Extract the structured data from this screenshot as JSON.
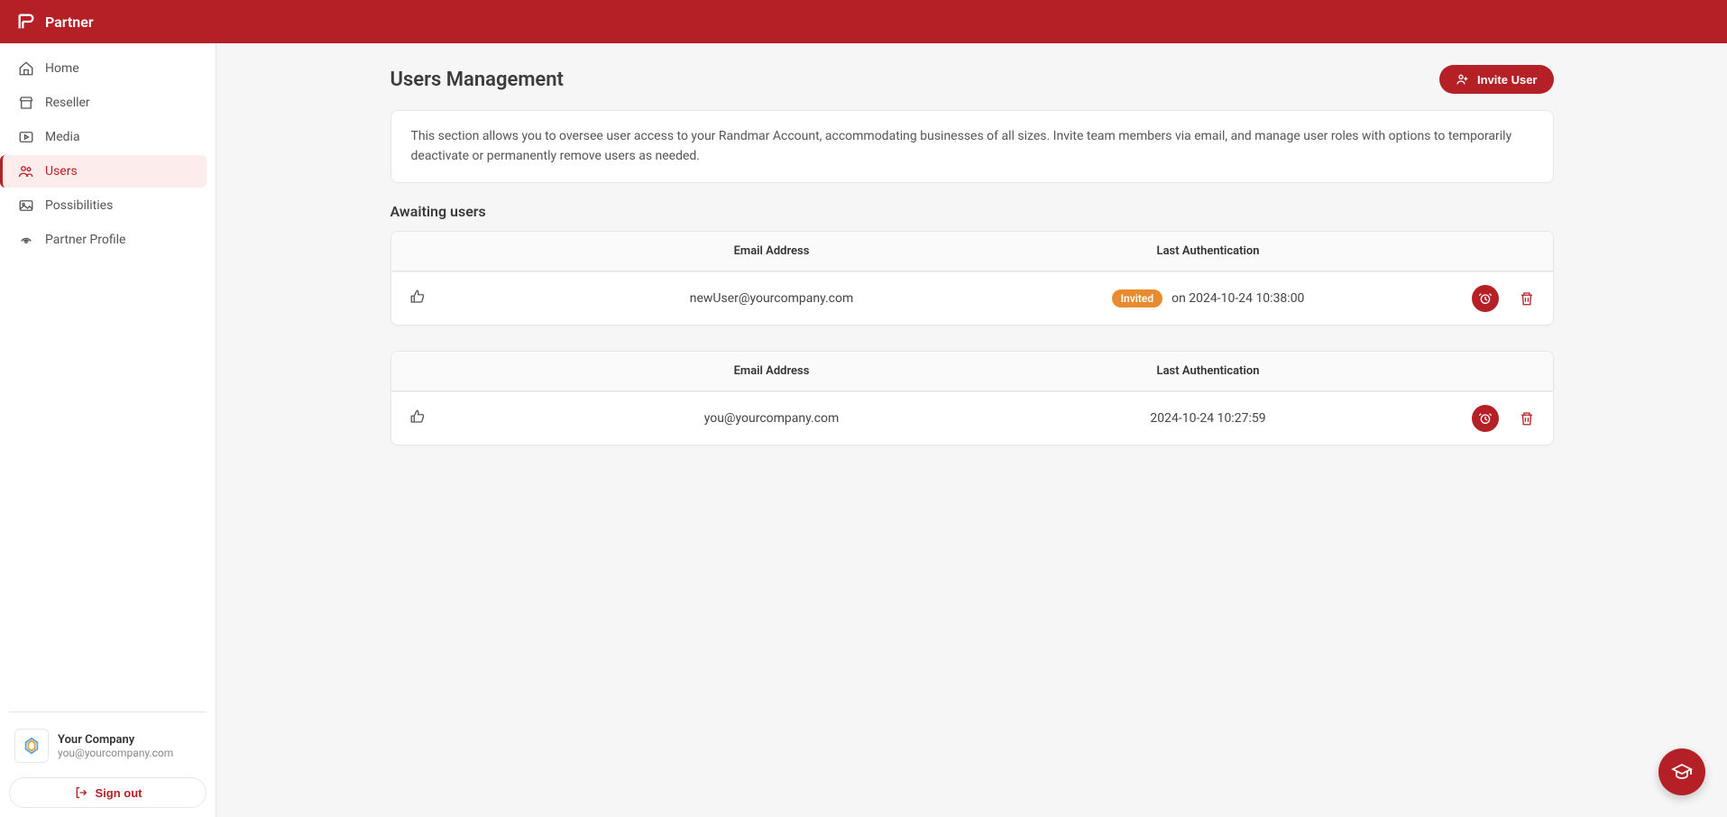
{
  "header": {
    "brand": "Partner"
  },
  "sidebar": {
    "items": [
      {
        "label": "Home"
      },
      {
        "label": "Reseller"
      },
      {
        "label": "Media"
      },
      {
        "label": "Users"
      },
      {
        "label": "Possibilities"
      },
      {
        "label": "Partner Profile"
      }
    ],
    "company": {
      "name": "Your Company",
      "email": "you@yourcompany.com"
    },
    "signout_label": "Sign out"
  },
  "page": {
    "title": "Users Management",
    "invite_label": "Invite User",
    "info_text": "This section allows you to oversee user access to your Randmar Account, accommodating businesses of all sizes. Invite team members via email, and manage user roles with options to temporarily deactivate or permanently remove users as needed.",
    "awaiting_title": "Awaiting users",
    "columns": {
      "email": "Email Address",
      "last_auth": "Last Authentication"
    },
    "awaiting_rows": [
      {
        "email": "newUser@yourcompany.com",
        "status_badge": "Invited",
        "last_auth": "on 2024-10-24 10:38:00"
      }
    ],
    "active_rows": [
      {
        "email": "you@yourcompany.com",
        "last_auth": "2024-10-24 10:27:59"
      }
    ]
  }
}
